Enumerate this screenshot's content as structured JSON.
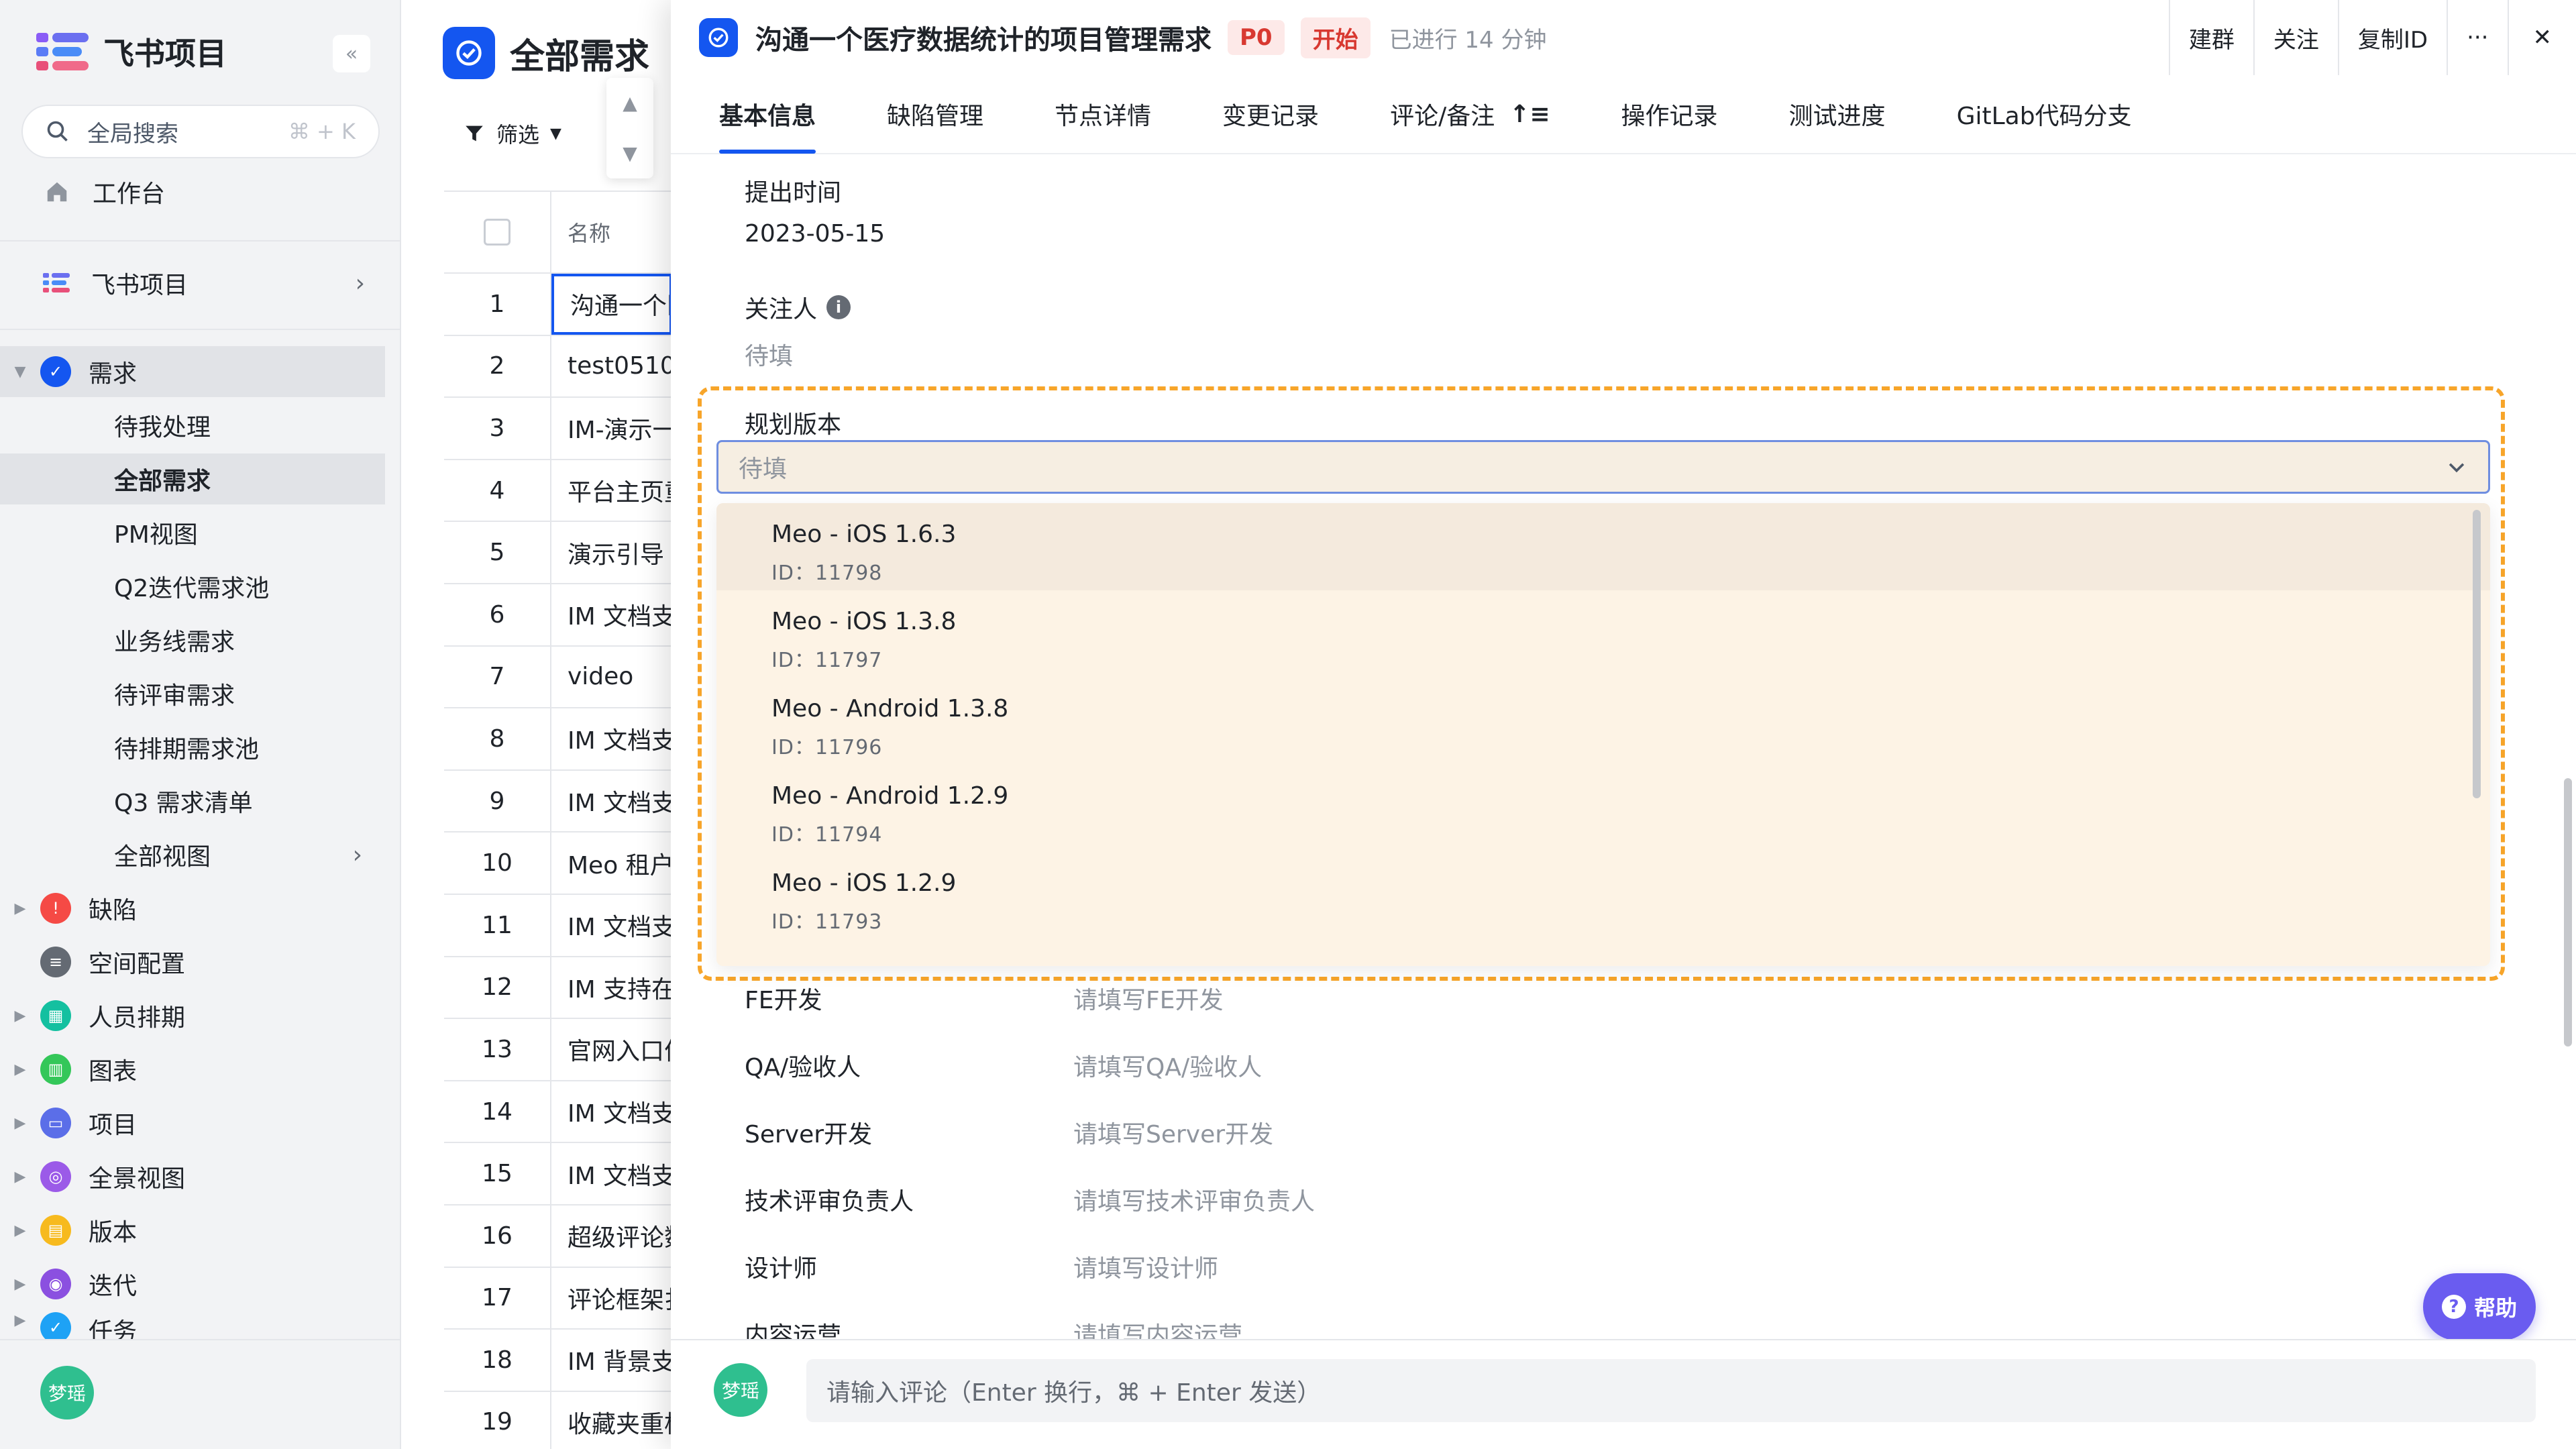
{
  "app": {
    "name": "飞书项目",
    "collapse_icon": "«",
    "search_placeholder": "全局搜索",
    "search_shortcut": "⌘ + K",
    "workbench": "工作台",
    "space_name": "飞书项目",
    "user_avatar": "梦瑶"
  },
  "sidebar": {
    "demand": "需求",
    "demand_items": [
      "待我处理",
      "全部需求",
      "PM视图",
      "Q2迭代需求池",
      "业务线需求",
      "待评审需求",
      "待排期需求池",
      "Q3 需求清单",
      "全部视图"
    ],
    "modules": [
      {
        "label": "缺陷",
        "color": "#f54a45",
        "glyph": "!"
      },
      {
        "label": "空间配置",
        "color": "#646a73",
        "glyph": "≡"
      },
      {
        "label": "人员排期",
        "color": "#14c0a0",
        "glyph": "▦"
      },
      {
        "label": "图表",
        "color": "#34c759",
        "glyph": "▥"
      },
      {
        "label": "项目",
        "color": "#5b6ee8",
        "glyph": "▭"
      },
      {
        "label": "全景视图",
        "color": "#9b5ae8",
        "glyph": "◎"
      },
      {
        "label": "版本",
        "color": "#f7ba1e",
        "glyph": "▤"
      },
      {
        "label": "迭代",
        "color": "#8b50e0",
        "glyph": "◉"
      },
      {
        "label": "任务",
        "color": "#1ea2f5",
        "glyph": "✓"
      }
    ]
  },
  "list": {
    "title": "全部需求",
    "filter": "筛选",
    "column_name": "名称",
    "rows": [
      {
        "n": "1",
        "name": "沟通一个医疗"
      },
      {
        "n": "2",
        "name": "test0510"
      },
      {
        "n": "3",
        "name": "IM-演示一"
      },
      {
        "n": "4",
        "name": "平台主页重"
      },
      {
        "n": "5",
        "name": "演示引导"
      },
      {
        "n": "6",
        "name": "IM 文档支"
      },
      {
        "n": "7",
        "name": "video"
      },
      {
        "n": "8",
        "name": "IM 文档支"
      },
      {
        "n": "9",
        "name": "IM 文档支"
      },
      {
        "n": "10",
        "name": "Meo 租户"
      },
      {
        "n": "11",
        "name": "IM 文档支"
      },
      {
        "n": "12",
        "name": "IM 支持在"
      },
      {
        "n": "13",
        "name": "官网入口优"
      },
      {
        "n": "14",
        "name": "IM 文档支"
      },
      {
        "n": "15",
        "name": "IM 文档支"
      },
      {
        "n": "16",
        "name": "超级评论数"
      },
      {
        "n": "17",
        "name": "评论框架扌"
      },
      {
        "n": "18",
        "name": "IM 背景支"
      },
      {
        "n": "19",
        "name": "收藏夹重构"
      }
    ]
  },
  "detail": {
    "title": "沟通一个医疗数据统计的项目管理需求",
    "priority": "P0",
    "status": "开始",
    "elapsed": "已进行 14 分钟",
    "actions": [
      "建群",
      "关注",
      "复制ID",
      "···",
      "✕"
    ],
    "tabs": [
      "基本信息",
      "缺陷管理",
      "节点详情",
      "变更记录",
      "评论/备注",
      "操作记录",
      "测试进度",
      "GitLab代码分支"
    ],
    "submit_time_label": "提出时间",
    "submit_time": "2023-05-15",
    "follower_label": "关注人",
    "follower_value": "待填",
    "plan_version_label": "规划版本",
    "plan_version_placeholder": "待填",
    "version_options": [
      {
        "name": "Meo - iOS 1.6.3",
        "id": "ID：11798"
      },
      {
        "name": "Meo - iOS 1.3.8",
        "id": "ID：11797"
      },
      {
        "name": "Meo - Android 1.3.8",
        "id": "ID：11796"
      },
      {
        "name": "Meo - Android 1.2.9",
        "id": "ID：11794"
      },
      {
        "name": "Meo - iOS 1.2.9",
        "id": "ID：11793"
      }
    ],
    "roles": [
      {
        "label": "FE开发",
        "placeholder": "请填写FE开发"
      },
      {
        "label": "QA/验收人",
        "placeholder": "请填写QA/验收人"
      },
      {
        "label": "Server开发",
        "placeholder": "请填写Server开发"
      },
      {
        "label": "技术评审负责人",
        "placeholder": "请填写技术评审负责人"
      },
      {
        "label": "设计师",
        "placeholder": "请填写设计师"
      },
      {
        "label": "内容运营",
        "placeholder": "请填写内容运营"
      }
    ],
    "comment_avatar": "梦瑶",
    "comment_placeholder": "请输入评论（Enter 换行，⌘ + Enter 发送）",
    "help": "帮助"
  },
  "colors": {
    "accent": "#1456f0",
    "highlight": "#f7a52a",
    "help": "#6a5cf0"
  }
}
